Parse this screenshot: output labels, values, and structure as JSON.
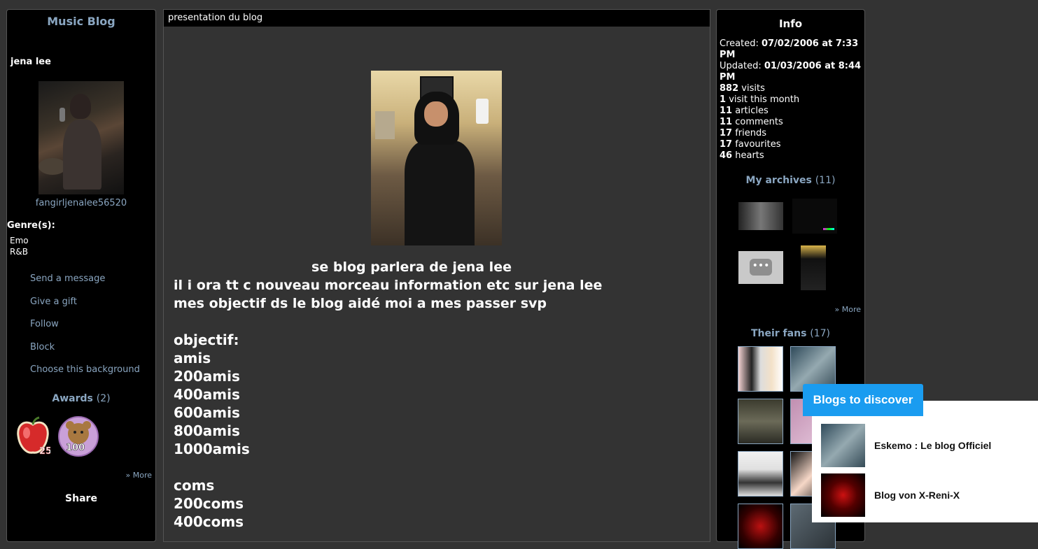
{
  "left": {
    "blog_title": "Music Blog",
    "owner_name": "jena lee",
    "username": "fangirljenalee56520",
    "genre_label": "Genre(s):",
    "genres": [
      "Emo",
      "R&B"
    ],
    "actions": [
      "Send a message",
      "Give a gift",
      "Follow",
      "Block",
      "Choose this background"
    ],
    "awards_label": "Awards",
    "awards_count": "(2)",
    "award_badge_number": "100",
    "award_apple_number": "25",
    "more": "» More",
    "share": "Share"
  },
  "center": {
    "header": "presentation du blog",
    "intro_lines": [
      "se blog parlera de jena lee",
      "il i ora tt c nouveau morceau information etc  sur jena lee",
      "mes objectif ds le blog aidé moi a mes passer svp"
    ],
    "list1": [
      "objectif:",
      "amis",
      "200amis",
      "400amis",
      "600amis",
      "800amis",
      "1000amis"
    ],
    "list2": [
      "coms",
      "200coms",
      "400coms"
    ]
  },
  "right": {
    "info_title": "Info",
    "created_label": "Created:",
    "created_value": "07/02/2006 at 7:33 PM",
    "updated_label": "Updated:",
    "updated_value": "01/03/2006 at 8:44 PM",
    "stats": [
      {
        "num": "882",
        "label": "visits"
      },
      {
        "num": "1",
        "label": "visit this month"
      },
      {
        "num": "11",
        "label": "articles"
      },
      {
        "num": "11",
        "label": "comments"
      },
      {
        "num": "17",
        "label": "friends"
      },
      {
        "num": "17",
        "label": "favourites"
      },
      {
        "num": "46",
        "label": "hearts"
      }
    ],
    "archives_label": "My archives",
    "archives_count": "(11)",
    "more": "» More",
    "fans_label": "Their fans",
    "fans_count": "(17)"
  },
  "discover": {
    "tab_label": "Blogs to discover",
    "items": [
      {
        "label": "Eskemo : Le blog Officiel"
      },
      {
        "label": "Blog von X-Reni-X"
      }
    ]
  }
}
